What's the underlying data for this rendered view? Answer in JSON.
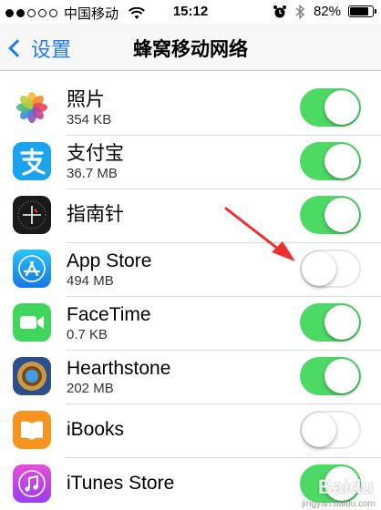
{
  "status_bar": {
    "carrier": "中国移动",
    "time": "15:12",
    "battery_percent": "82%",
    "battery_level": 0.82
  },
  "nav": {
    "back_label": "设置",
    "title": "蜂窝移动网络"
  },
  "apps": [
    {
      "name": "照片",
      "size": "354 KB",
      "enabled": true,
      "icon": "photos-icon"
    },
    {
      "name": "支付宝",
      "size": "36.7 MB",
      "enabled": true,
      "icon": "alipay-icon"
    },
    {
      "name": "指南针",
      "size": "",
      "enabled": true,
      "icon": "compass-icon"
    },
    {
      "name": "App Store",
      "size": "494 MB",
      "enabled": false,
      "icon": "app-store-icon"
    },
    {
      "name": "FaceTime",
      "size": "0.7 KB",
      "enabled": true,
      "icon": "facetime-icon"
    },
    {
      "name": "Hearthstone",
      "size": "202 MB",
      "enabled": true,
      "icon": "hearthstone-icon"
    },
    {
      "name": "iBooks",
      "size": "",
      "enabled": false,
      "icon": "ibooks-icon"
    },
    {
      "name": "iTunes Store",
      "size": "",
      "enabled": true,
      "icon": "itunes-store-icon"
    }
  ],
  "colors": {
    "toggle_on": "#4cd964",
    "accent": "#1e7bf5",
    "annotation_arrow": "#f0302e"
  },
  "watermark": {
    "logo": "Baidu",
    "subtext": "jingyan.baidu.com"
  }
}
